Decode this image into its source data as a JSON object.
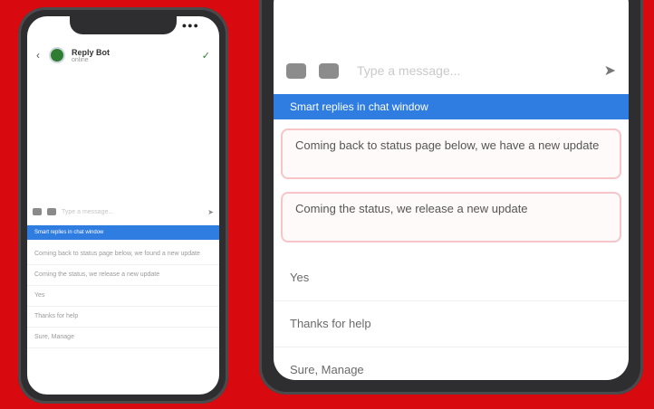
{
  "colors": {
    "background": "#d80a10",
    "banner": "#2f7de0",
    "accent": "#2e7d32",
    "card_border": "#f7c5c7"
  },
  "small_phone": {
    "status": "●●●",
    "header": {
      "name": "Reply Bot",
      "status": "online"
    },
    "composer": {
      "placeholder": "Type a message..."
    },
    "banner": "Smart replies in chat window",
    "rows": [
      "Coming back to status page below, we found a new update",
      "Coming the status, we release a new update",
      "Yes",
      "Thanks for help",
      "Sure, Manage"
    ]
  },
  "large_phone": {
    "composer": {
      "placeholder": "Type a message..."
    },
    "banner": "Smart replies in chat window",
    "suggestions": [
      "Coming back to status page below, we have a new update",
      "Coming the status, we release a new update"
    ],
    "rows": [
      "Yes",
      "Thanks for help",
      "Sure, Manage"
    ]
  },
  "icons": {
    "back": "back-arrow-icon",
    "verified": "check-icon",
    "camera": "camera-icon",
    "image": "image-icon",
    "send": "send-icon"
  }
}
